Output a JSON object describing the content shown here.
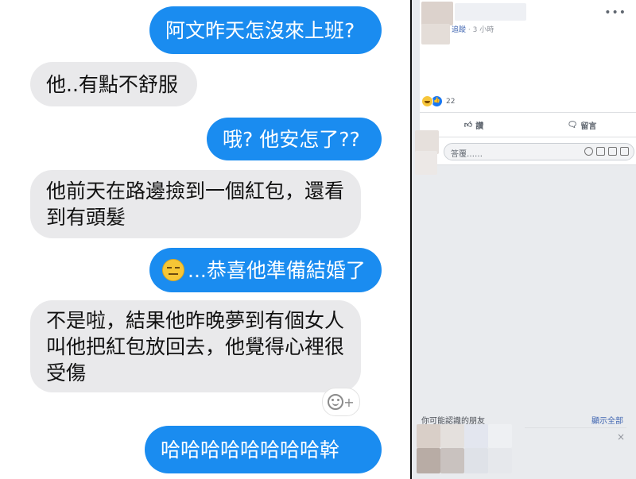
{
  "chat": {
    "messages": [
      {
        "from": "me",
        "text": "阿文昨天怎沒來上班?"
      },
      {
        "from": "them",
        "text": "他..有點不舒服"
      },
      {
        "from": "me",
        "text": "哦? 他安怎了??"
      },
      {
        "from": "them",
        "text": "他前天在路邊撿到一個紅包，還看到有頭髮"
      },
      {
        "from": "me",
        "text": "...恭喜他準備結婚了",
        "emoji": "expressionless-face"
      },
      {
        "from": "them",
        "text": "不是啦，結果他昨晚夢到有個女人叫他把紅包放回去，他覺得心裡很受傷"
      },
      {
        "from": "me",
        "text": "哈哈哈哈哈哈哈哈幹"
      }
    ],
    "react_plus": "+"
  },
  "facebook": {
    "follow": "追蹤",
    "time": "3 小時",
    "more": "•••",
    "reaction_count": "22",
    "like_label": "讚",
    "comment_label": "留言",
    "comment_placeholder": "答覆……",
    "pymk_title": "你可能認識的朋友",
    "see_all": "顯示全部",
    "close": "×",
    "colors": {
      "me_bubble": "#1a8cf0",
      "them_bubble": "#e9e9eb",
      "fb_link": "#4267b2"
    }
  }
}
